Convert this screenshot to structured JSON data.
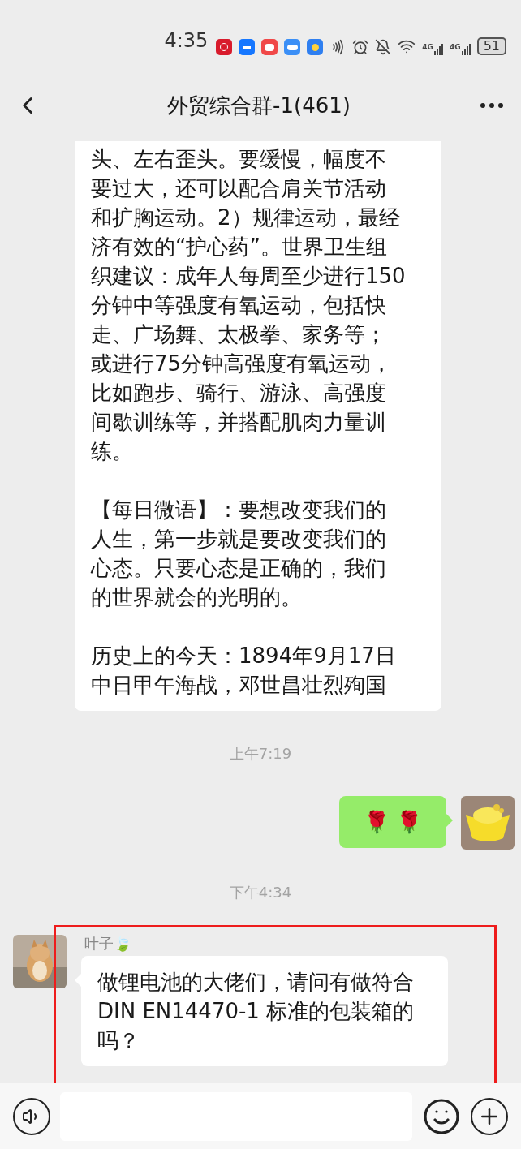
{
  "status_bar": {
    "time": "4:35",
    "network": [
      "4G",
      "4G"
    ],
    "battery": "51"
  },
  "header": {
    "title": "外贸综合群-1(461)"
  },
  "messages": [
    {
      "kind": "text",
      "outgoing": false,
      "highlighted": false,
      "paragraphs": [
        [
          "头、左右歪头。要缓慢，幅度不",
          "要过大，还可以配合肩关节活动",
          "和扩胸运动。2）规律运动，最经",
          "济有效的“护心药”。世界卫生组",
          "织建议：成年人每周至少进行150",
          "分钟中等强度有氧运动，包括快",
          "走、广场舞、太极拳、家务等；",
          "或进行75分钟高强度有氧运动，",
          "比如跑步、骑行、游泳、高强度",
          "间歇训练等，并搭配肌肉力量训",
          "练。"
        ],
        [
          "【每日微语】：要想改变我们的",
          "人生，第一步就是要改变我们的",
          "心态。只要心态是正确的，我们",
          "的世界就会的光明的。"
        ],
        [
          "历史上的今天：1894年9月17日",
          "中日甲午海战，邓世昌壮烈殉国"
        ]
      ]
    },
    {
      "kind": "time",
      "text": "上午7:19"
    },
    {
      "kind": "text",
      "outgoing": true,
      "highlighted": false,
      "avatar": true,
      "paragraphs": [
        [
          "🌹 🌹"
        ]
      ]
    },
    {
      "kind": "time",
      "text": "下午4:34"
    },
    {
      "kind": "text",
      "outgoing": false,
      "highlighted": true,
      "avatar": true,
      "sender": "叶子🍃",
      "paragraphs": [
        [
          "做锂电池的大佬们，请问有做符合",
          "DIN EN14470-1 标准的包装箱的",
          "吗？"
        ]
      ]
    }
  ]
}
